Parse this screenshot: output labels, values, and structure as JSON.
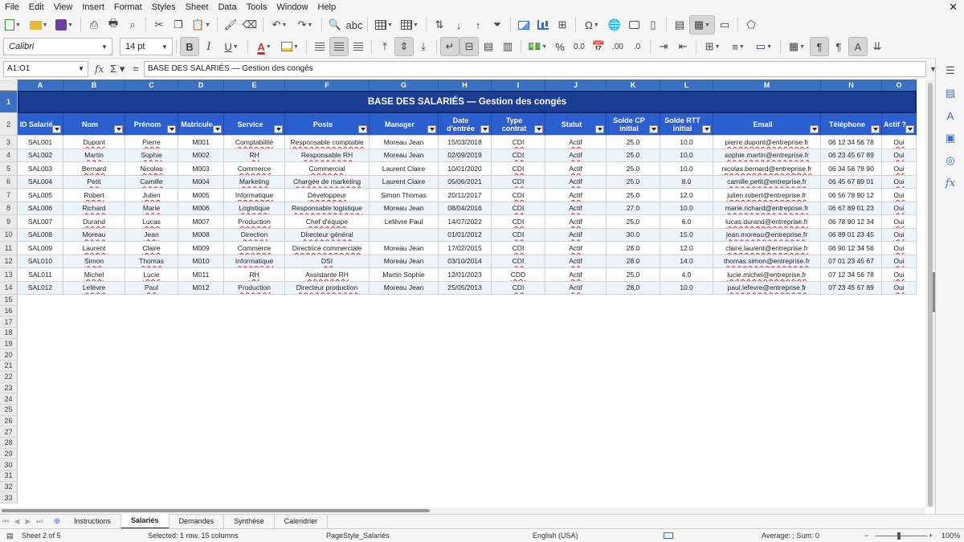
{
  "menu": [
    "File",
    "Edit",
    "View",
    "Insert",
    "Format",
    "Styles",
    "Sheet",
    "Data",
    "Tools",
    "Window",
    "Help"
  ],
  "font": {
    "name": "Calibri",
    "size": "14 pt"
  },
  "namebox": "A1:O1",
  "formula": "BASE DES SALARIÉS — Gestion des congés",
  "columns": [
    "A",
    "B",
    "C",
    "D",
    "E",
    "F",
    "G",
    "H",
    "I",
    "J",
    "K",
    "L",
    "M",
    "N",
    "O"
  ],
  "sheet_title": "BASE DES SALARIÉS — Gestion des congés",
  "headers": [
    "ID Salarié",
    "Nom",
    "Prénom",
    "Matricule",
    "Service",
    "Poste",
    "Manager",
    "Date\nd'entrée",
    "Type\ncontrat",
    "Statut",
    "Solde CP\ninitial",
    "Solde RTT\ninitial",
    "Email",
    "Téléphone",
    "Actif ?"
  ],
  "rows": [
    [
      "SAL001",
      "Dupont",
      "Pierre",
      "M001",
      "Comptabilité",
      "Responsable comptable",
      "Moreau Jean",
      "15/03/2018",
      "CDI",
      "Actif",
      "25.0",
      "10.0",
      "pierre.dupont@entreprise.fr",
      "06 12 34 56 78",
      "Oui"
    ],
    [
      "SAL002",
      "Martin",
      "Sophie",
      "M002",
      "RH",
      "Responsable RH",
      "Moreau Jean",
      "02/09/2019",
      "CDI",
      "Actif",
      "25.0",
      "10.0",
      "sophie.martin@entreprise.fr",
      "06 23 45 67 89",
      "Oui"
    ],
    [
      "SAL003",
      "Bernard",
      "Nicolas",
      "M003",
      "Commerce",
      "Commercial",
      "Laurent Claire",
      "10/01/2020",
      "CDI",
      "Actif",
      "25.0",
      "10.0",
      "nicolas.bernard@entreprise.fr",
      "06 34 56 78 90",
      "Oui"
    ],
    [
      "SAL004",
      "Petit",
      "Camille",
      "M004",
      "Marketing",
      "Chargée de marketing",
      "Laurent Claire",
      "05/06/2021",
      "CDI",
      "Actif",
      "25.0",
      "8.0",
      "camille.petit@entreprise.fr",
      "06 45 67 89 01",
      "Oui"
    ],
    [
      "SAL005",
      "Robert",
      "Julien",
      "M005",
      "Informatique",
      "Développeur",
      "Simon Thomas",
      "20/11/2017",
      "CDI",
      "Actif",
      "25.0",
      "12.0",
      "julien.robert@entreprise.fr",
      "06 56 78 90 12",
      "Oui"
    ],
    [
      "SAL006",
      "Richard",
      "Marie",
      "M006",
      "Logistique",
      "Responsable logistique",
      "Moreau Jean",
      "08/04/2016",
      "CDI",
      "Actif",
      "27.0",
      "10.0",
      "marie.richard@entreprise.fr",
      "06 67 89 01 23",
      "Oui"
    ],
    [
      "SAL007",
      "Durand",
      "Lucas",
      "M007",
      "Production",
      "Chef d'équipe",
      "Lefèvre Paul",
      "14/07/2022",
      "CDI",
      "Actif",
      "25.0",
      "6.0",
      "lucas.durand@entreprise.fr",
      "06 78 90 12 34",
      "Oui"
    ],
    [
      "SAL008",
      "Moreau",
      "Jean",
      "M008",
      "Direction",
      "Directeur général",
      "",
      "01/01/2012",
      "CDI",
      "Actif",
      "30.0",
      "15.0",
      "jean.moreau@entreprise.fr",
      "06 89 01 23 45",
      "Oui"
    ],
    [
      "SAL009",
      "Laurent",
      "Claire",
      "M009",
      "Commerce",
      "Directrice commerciale",
      "Moreau Jean",
      "17/02/2015",
      "CDI",
      "Actif",
      "28.0",
      "12.0",
      "claire.laurent@entreprise.fr",
      "06 90 12 34 56",
      "Oui"
    ],
    [
      "SAL010",
      "Simon",
      "Thomas",
      "M010",
      "Informatique",
      "DSI",
      "Moreau Jean",
      "03/10/2014",
      "CDI",
      "Actif",
      "28.0",
      "14.0",
      "thomas.simon@entreprise.fr",
      "07 01 23 45 67",
      "Oui"
    ],
    [
      "SAL011",
      "Michel",
      "Lucie",
      "M011",
      "RH",
      "Assistante RH",
      "Martin Sophie",
      "12/01/2023",
      "CDD",
      "Actif",
      "25.0",
      "4.0",
      "lucie.michel@entreprise.fr",
      "07 12 34 56 78",
      "Oui"
    ],
    [
      "SAL012",
      "Lefèvre",
      "Paul",
      "M012",
      "Production",
      "Directeur production",
      "Moreau Jean",
      "25/05/2013",
      "CDI",
      "Actif",
      "28.0",
      "10.0",
      "paul.lefevre@entreprise.fr",
      "07 23 45 67 89",
      "Oui"
    ]
  ],
  "empty_rows": [
    "15",
    "16",
    "17",
    "18",
    "19",
    "20",
    "21",
    "22",
    "23",
    "24",
    "25",
    "26",
    "27",
    "28",
    "29",
    "30",
    "31",
    "32",
    "33"
  ],
  "tabs": [
    "Instructions",
    "Salariés",
    "Demandes",
    "Synthèse",
    "Calendrier"
  ],
  "active_tab": "Salariés",
  "status": {
    "sheet": "Sheet 2 of 5",
    "selection": "Selected: 1 row, 15 columns",
    "page_style": "PageStyle_Salariés",
    "language": "English (USA)",
    "summary": "Average: ; Sum: 0",
    "zoom": "100%"
  },
  "colors": {
    "header_blue": "#2b5fd0",
    "title_navy": "#1b3d94",
    "alt_row": "#eef4fc",
    "accent": "#3a6fc4"
  }
}
